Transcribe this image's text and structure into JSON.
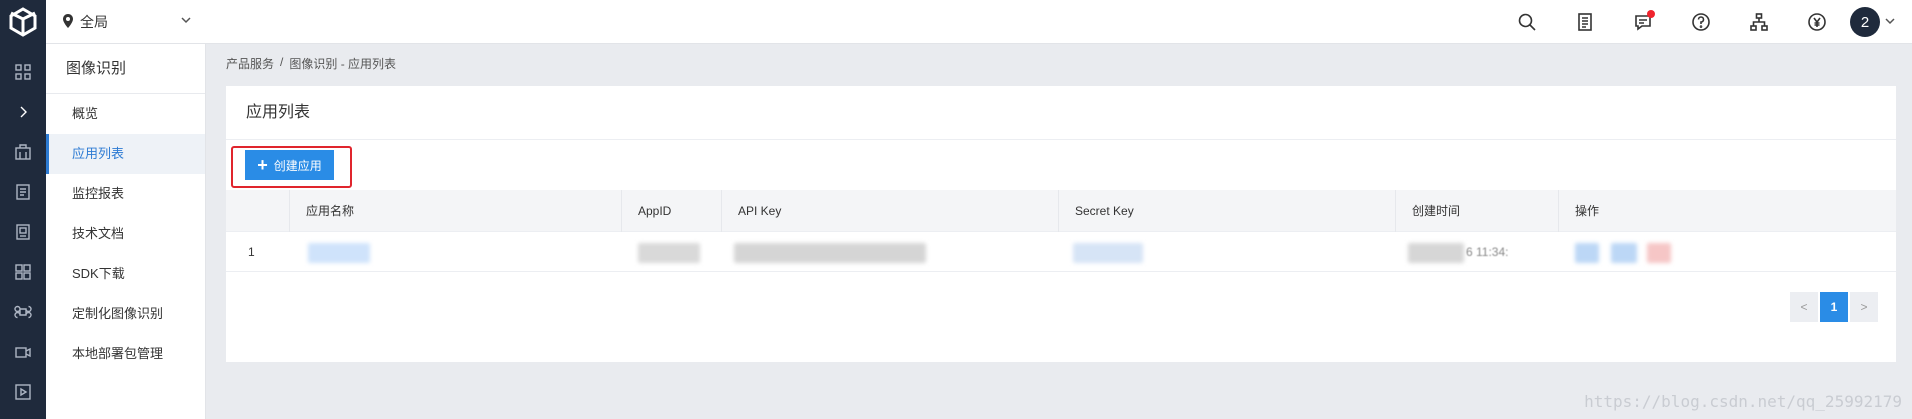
{
  "rail": {
    "items": [
      "logo-icon",
      "grid-icon",
      "expand-icon",
      "building-icon",
      "report-icon",
      "document-icon",
      "apps-icon",
      "command-icon",
      "video-icon",
      "play-icon"
    ]
  },
  "topbar": {
    "region_label": "全局",
    "icons": [
      "search-icon",
      "clipboard-icon",
      "message-icon",
      "help-icon",
      "org-icon",
      "billing-icon"
    ],
    "avatar_text": "2"
  },
  "subnav": {
    "title": "图像识别",
    "items": [
      "概览",
      "应用列表",
      "监控报表",
      "技术文档",
      "SDK下载",
      "定制化图像识别",
      "本地部署包管理"
    ],
    "active_index": 1
  },
  "breadcrumb": {
    "parts": [
      "产品服务",
      "/",
      "图像识别 - 应用列表"
    ]
  },
  "panel": {
    "title": "应用列表",
    "create_button": "创建应用"
  },
  "table": {
    "headers": [
      "",
      "应用名称",
      "AppID",
      "API Key",
      "Secret Key",
      "创建时间",
      "操作"
    ],
    "rows": [
      {
        "index": "1",
        "time_fragment": "6 11:34:"
      }
    ]
  },
  "pagination": {
    "prev": "<",
    "current": "1",
    "next": ">"
  },
  "watermark": "https://blog.csdn.net/qq_25992179",
  "colors": {
    "rail_bg": "#1f2a3c",
    "accent": "#2a8ce6",
    "highlight_border": "#e0252d",
    "badge_red": "#f0232d"
  }
}
